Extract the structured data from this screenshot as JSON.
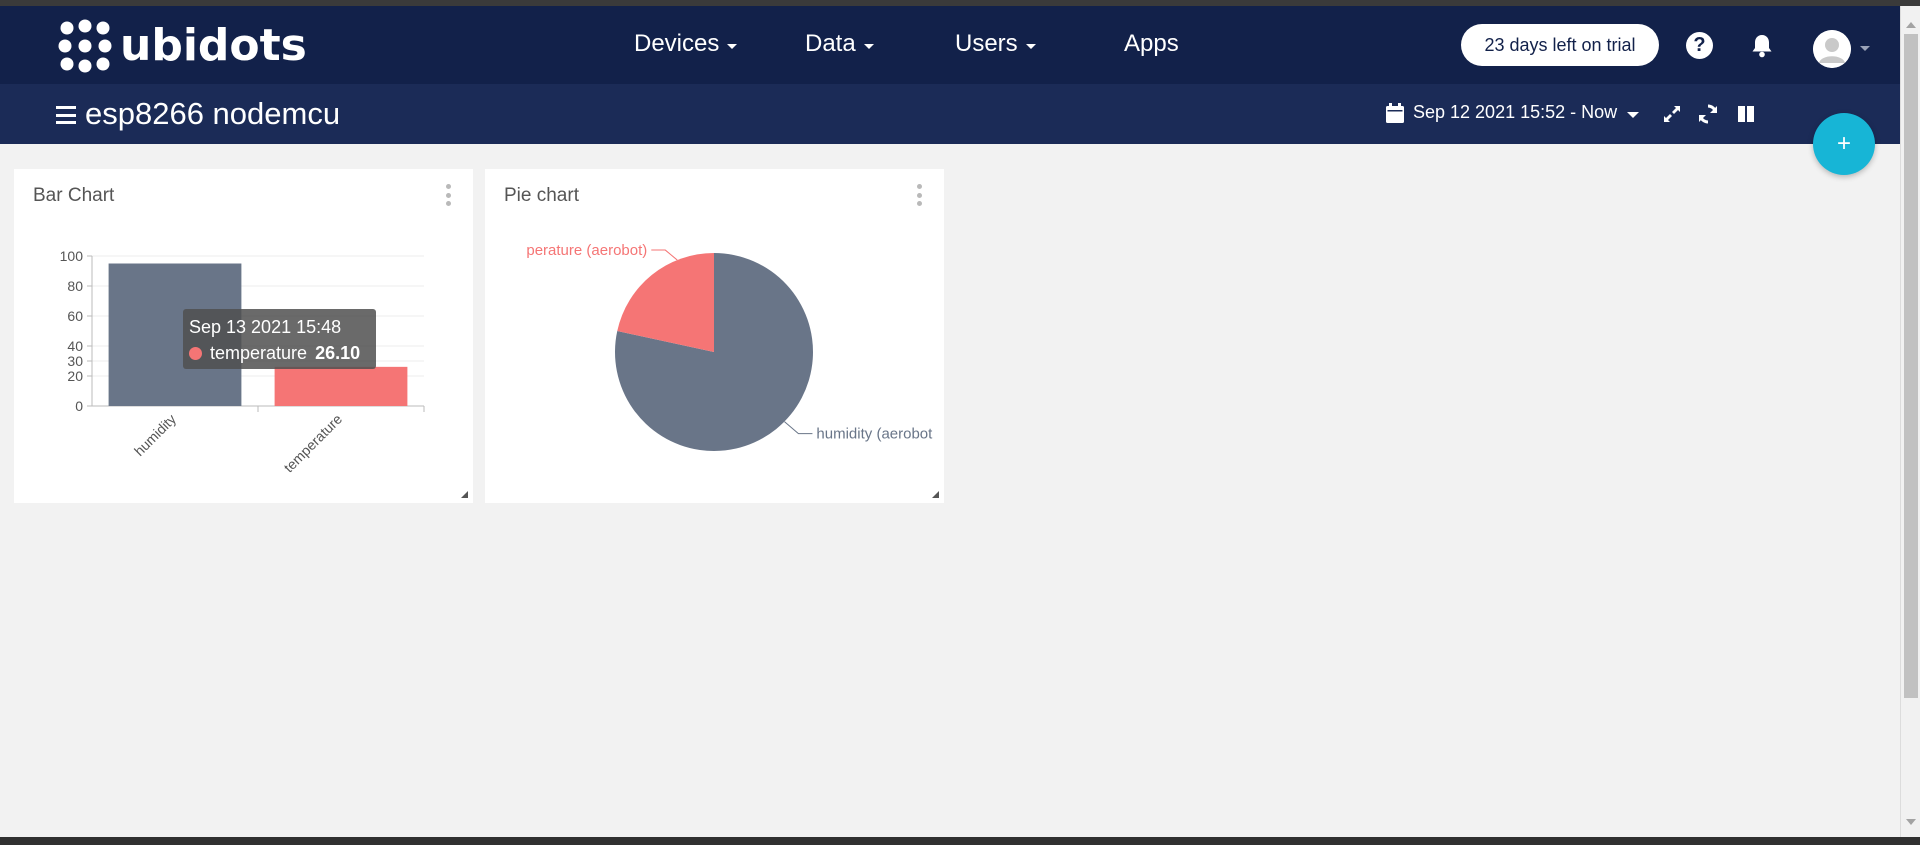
{
  "app": {
    "brand": "ubidots"
  },
  "nav": {
    "items": [
      {
        "label": "Devices",
        "dropdown": true
      },
      {
        "label": "Data",
        "dropdown": true
      },
      {
        "label": "Users",
        "dropdown": true
      },
      {
        "label": "Apps",
        "dropdown": false
      }
    ],
    "trial_label": "23 days left on trial",
    "help_label": "?"
  },
  "dashboard": {
    "title": "esp8266 nodemcu",
    "date_range": "Sep 12 2021 15:52 - Now",
    "fab_label": "+"
  },
  "colors": {
    "navbar": "#12214a",
    "subbar": "#1b2b57",
    "fab": "#17b5d6",
    "series_humidity": "#697588",
    "series_temperature": "#f57575"
  },
  "widgets": [
    {
      "title": "Bar Chart"
    },
    {
      "title": "Pie chart"
    }
  ],
  "chart_data": [
    {
      "type": "bar",
      "title": "Bar Chart",
      "categories": [
        "humidity",
        "temperature"
      ],
      "values": [
        95,
        26.1
      ],
      "colors": [
        "#697588",
        "#f57575"
      ],
      "y_ticks": [
        0,
        20,
        30,
        40,
        60,
        80,
        100
      ],
      "ylim": [
        0,
        100
      ],
      "grid": true,
      "tooltip": {
        "date": "Sep 13 2021 15:48",
        "series": "temperature",
        "value": "26.10"
      }
    },
    {
      "type": "pie",
      "title": "Pie chart",
      "labels": [
        "humidity (aerobot",
        "perature (aerobot)"
      ],
      "values": [
        78.4,
        21.6
      ],
      "colors": [
        "#697588",
        "#f57575"
      ]
    }
  ]
}
